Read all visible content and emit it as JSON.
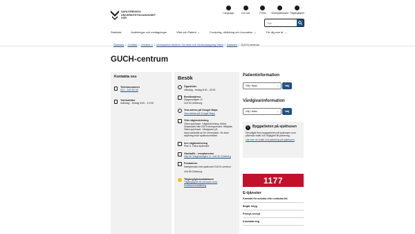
{
  "logo": {
    "line1": "SAHLGRENSKA",
    "line2": "UNIVERSITETSSJUKHUSET",
    "line3": "VGR"
  },
  "top_tools": [
    {
      "label": "Language",
      "icon": "language-icon"
    },
    {
      "label": "Om oss",
      "icon": "info-icon"
    },
    {
      "label": "Press",
      "icon": "press-icon"
    },
    {
      "label": "Webbplatskarta",
      "icon": "sitemap-icon"
    },
    {
      "label": "Tillgänglighet",
      "icon": "accessibility-icon"
    }
  ],
  "search": {
    "placeholder": "Sök"
  },
  "nav": [
    {
      "label": "Startsida",
      "has_menu": false
    },
    {
      "label": "Avdelningar och mottagningar",
      "has_menu": false
    },
    {
      "label": "Vård och Patient",
      "has_menu": true
    },
    {
      "label": "Forskning, utbildning och innovation",
      "has_menu": true
    },
    {
      "label": "För dig som är",
      "has_menu": true
    }
  ],
  "breadcrumb": {
    "items": [
      "Startsida",
      "Område",
      "Område 2",
      "Verksamhet Medicin Geriatrik och Akutmottagning Östra",
      "Diabetes"
    ],
    "current": "GUCH-centrum"
  },
  "page_title": "GUCH-centrum",
  "contact": {
    "heading": "Kontakta oss",
    "phone_label": "Telefonnummer",
    "phone_value": "031 - 343 59 00",
    "hours_label": "Telefontider",
    "hours_value": "måndag - fredag 9:00 - 12:00"
  },
  "besok": {
    "heading": "Besök",
    "opening_label": "Öppettider",
    "opening_value": "måndag - fredag 8:00 - 16:00",
    "address_label": "Besöksadress",
    "address_line1": "Diagnosvägen 11",
    "address_line2": "416 50 Göteborg",
    "maps_label": "Visa adress på Google Maps",
    "maps_link": "Visa adress på Google Maps",
    "outdoor_label": "Yttre vägbeskrivning",
    "outdoor_text": "Östra sjukhuset. Vägbeskrivning: Avfart Sinjesnidet från E20 Kvibergsmotet. Hållplats Östra sjukhuset. Vårdgivare på www.vasttrafik.se för information. Se även skyltning inom sjukhusområdet.",
    "indoor_label": "Inre vägbeskrivning",
    "indoor_text": "Plan 0, Östra sjukhuset",
    "transit_label": "Västtrafik - reseplanerare",
    "transit_link": "Välj hit: Diagnosvägen 11, 416 50 Göteborg",
    "postal_label": "Postadress",
    "postal_line1": "Sahlgrenska Univ.sjukhuset GUCH-centrum",
    "postal_line2": "416 85 Göteborg",
    "access_label": "Tillgänglighetsdatabasen",
    "access_link": "Tillgänglighet för personer med funktionsnedsättning"
  },
  "right": {
    "patient_heading": "Patientinformation",
    "select_label": "Välj i listan",
    "select_button": "Välj",
    "care_heading": "Vårdgivarinformation",
    "notice_title": "Byggarbeten på sjukhusen",
    "notice_text": "Det pågår flera byggarbeten på sjukhusen som påverkar trafik och möjlighet till parkering.",
    "notice_link": "Läs mer om trafik och parkering på sjukhusen",
    "banner_text": "1177",
    "eservices_heading": "E-tjänster",
    "eservices": [
      "Kontakt för avboka eller omboka tid",
      "Begär intyg",
      "Förnya recept",
      "Kontakta mig"
    ]
  },
  "colors": {
    "link": "#205081",
    "accent": "#205081",
    "banner_1177": "#c3112b",
    "panel": "#f1f1f1"
  }
}
